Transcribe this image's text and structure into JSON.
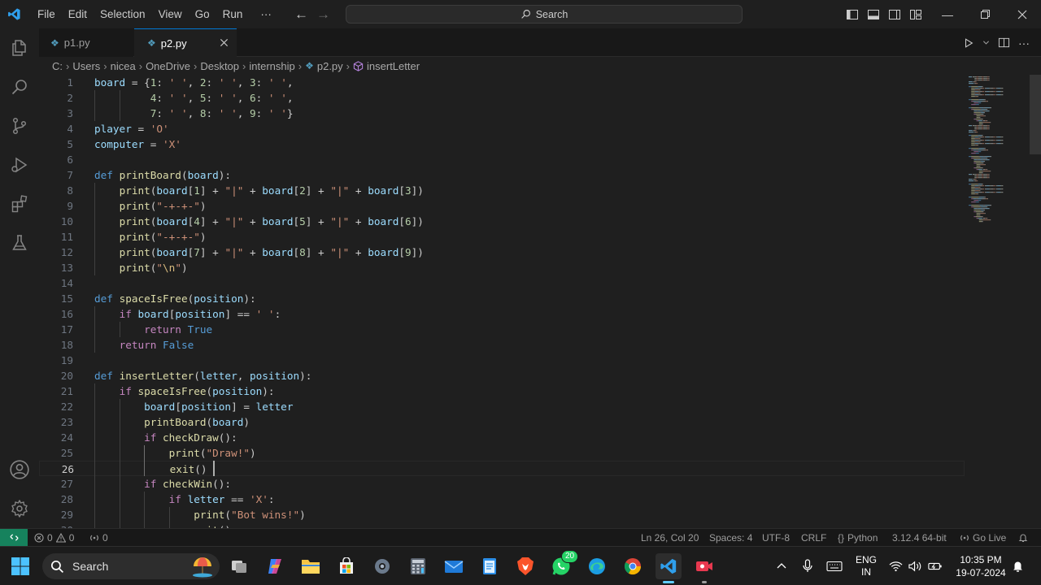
{
  "menu": [
    "File",
    "Edit",
    "Selection",
    "View",
    "Go",
    "Run",
    "···"
  ],
  "search": {
    "label": "Search"
  },
  "tabs": [
    {
      "label": "p1.py",
      "active": false
    },
    {
      "label": "p2.py",
      "active": true
    }
  ],
  "breadcrumb": [
    "C:",
    "Users",
    "nicea",
    "OneDrive",
    "Desktop",
    "internship",
    "p2.py",
    "insertLetter"
  ],
  "editor": {
    "current_line": 26,
    "lines": [
      [
        [
          "v",
          "board"
        ],
        [
          "o",
          " = {"
        ],
        [
          "n",
          "1"
        ],
        [
          "o",
          ": "
        ],
        [
          "s",
          "' '"
        ],
        [
          "o",
          ", "
        ],
        [
          "n",
          "2"
        ],
        [
          "o",
          ": "
        ],
        [
          "s",
          "' '"
        ],
        [
          "o",
          ", "
        ],
        [
          "n",
          "3"
        ],
        [
          "o",
          ": "
        ],
        [
          "s",
          "' '"
        ],
        [
          "o",
          ","
        ]
      ],
      [
        [
          "o",
          "         "
        ],
        [
          "n",
          "4"
        ],
        [
          "o",
          ": "
        ],
        [
          "s",
          "' '"
        ],
        [
          "o",
          ", "
        ],
        [
          "n",
          "5"
        ],
        [
          "o",
          ": "
        ],
        [
          "s",
          "' '"
        ],
        [
          "o",
          ", "
        ],
        [
          "n",
          "6"
        ],
        [
          "o",
          ": "
        ],
        [
          "s",
          "' '"
        ],
        [
          "o",
          ","
        ]
      ],
      [
        [
          "o",
          "         "
        ],
        [
          "n",
          "7"
        ],
        [
          "o",
          ": "
        ],
        [
          "s",
          "' '"
        ],
        [
          "o",
          ", "
        ],
        [
          "n",
          "8"
        ],
        [
          "o",
          ": "
        ],
        [
          "s",
          "' '"
        ],
        [
          "o",
          ", "
        ],
        [
          "n",
          "9"
        ],
        [
          "o",
          ": "
        ],
        [
          "s",
          "' '"
        ],
        [
          "o",
          "}"
        ]
      ],
      [
        [
          "v",
          "player"
        ],
        [
          "o",
          " = "
        ],
        [
          "s",
          "'O'"
        ]
      ],
      [
        [
          "v",
          "computer"
        ],
        [
          "o",
          " = "
        ],
        [
          "s",
          "'X'"
        ]
      ],
      [],
      [
        [
          "k",
          "def "
        ],
        [
          "f",
          "printBoard"
        ],
        [
          "o",
          "("
        ],
        [
          "v",
          "board"
        ],
        [
          "o",
          "):"
        ]
      ],
      [
        [
          "o",
          "    "
        ],
        [
          "f",
          "print"
        ],
        [
          "o",
          "("
        ],
        [
          "v",
          "board"
        ],
        [
          "o",
          "["
        ],
        [
          "n",
          "1"
        ],
        [
          "o",
          "] + "
        ],
        [
          "s",
          "\"|\""
        ],
        [
          "o",
          " + "
        ],
        [
          "v",
          "board"
        ],
        [
          "o",
          "["
        ],
        [
          "n",
          "2"
        ],
        [
          "o",
          "] + "
        ],
        [
          "s",
          "\"|\""
        ],
        [
          "o",
          " + "
        ],
        [
          "v",
          "board"
        ],
        [
          "o",
          "["
        ],
        [
          "n",
          "3"
        ],
        [
          "o",
          "])"
        ]
      ],
      [
        [
          "o",
          "    "
        ],
        [
          "f",
          "print"
        ],
        [
          "o",
          "("
        ],
        [
          "s",
          "\"-+-+-\""
        ],
        [
          "o",
          ")"
        ]
      ],
      [
        [
          "o",
          "    "
        ],
        [
          "f",
          "print"
        ],
        [
          "o",
          "("
        ],
        [
          "v",
          "board"
        ],
        [
          "o",
          "["
        ],
        [
          "n",
          "4"
        ],
        [
          "o",
          "] + "
        ],
        [
          "s",
          "\"|\""
        ],
        [
          "o",
          " + "
        ],
        [
          "v",
          "board"
        ],
        [
          "o",
          "["
        ],
        [
          "n",
          "5"
        ],
        [
          "o",
          "] + "
        ],
        [
          "s",
          "\"|\""
        ],
        [
          "o",
          " + "
        ],
        [
          "v",
          "board"
        ],
        [
          "o",
          "["
        ],
        [
          "n",
          "6"
        ],
        [
          "o",
          "])"
        ]
      ],
      [
        [
          "o",
          "    "
        ],
        [
          "f",
          "print"
        ],
        [
          "o",
          "("
        ],
        [
          "s",
          "\"-+-+-\""
        ],
        [
          "o",
          ")"
        ]
      ],
      [
        [
          "o",
          "    "
        ],
        [
          "f",
          "print"
        ],
        [
          "o",
          "("
        ],
        [
          "v",
          "board"
        ],
        [
          "o",
          "["
        ],
        [
          "n",
          "7"
        ],
        [
          "o",
          "] + "
        ],
        [
          "s",
          "\"|\""
        ],
        [
          "o",
          " + "
        ],
        [
          "v",
          "board"
        ],
        [
          "o",
          "["
        ],
        [
          "n",
          "8"
        ],
        [
          "o",
          "] + "
        ],
        [
          "s",
          "\"|\""
        ],
        [
          "o",
          " + "
        ],
        [
          "v",
          "board"
        ],
        [
          "o",
          "["
        ],
        [
          "n",
          "9"
        ],
        [
          "o",
          "])"
        ]
      ],
      [
        [
          "o",
          "    "
        ],
        [
          "f",
          "print"
        ],
        [
          "o",
          "("
        ],
        [
          "s",
          "\""
        ],
        [
          "e",
          "\\n"
        ],
        [
          "s",
          "\""
        ],
        [
          "o",
          ")"
        ]
      ],
      [],
      [
        [
          "k",
          "def "
        ],
        [
          "f",
          "spaceIsFree"
        ],
        [
          "o",
          "("
        ],
        [
          "v",
          "position"
        ],
        [
          "o",
          "):"
        ]
      ],
      [
        [
          "o",
          "    "
        ],
        [
          "c",
          "if "
        ],
        [
          "v",
          "board"
        ],
        [
          "o",
          "["
        ],
        [
          "v",
          "position"
        ],
        [
          "o",
          "] == "
        ],
        [
          "s",
          "' '"
        ],
        [
          "o",
          ":"
        ]
      ],
      [
        [
          "o",
          "        "
        ],
        [
          "c",
          "return "
        ],
        [
          "k",
          "True"
        ]
      ],
      [
        [
          "o",
          "    "
        ],
        [
          "c",
          "return "
        ],
        [
          "k",
          "False"
        ]
      ],
      [],
      [
        [
          "k",
          "def "
        ],
        [
          "f",
          "insertLetter"
        ],
        [
          "o",
          "("
        ],
        [
          "v",
          "letter"
        ],
        [
          "o",
          ", "
        ],
        [
          "v",
          "position"
        ],
        [
          "o",
          "):"
        ]
      ],
      [
        [
          "o",
          "    "
        ],
        [
          "c",
          "if "
        ],
        [
          "f",
          "spaceIsFree"
        ],
        [
          "o",
          "("
        ],
        [
          "v",
          "position"
        ],
        [
          "o",
          "):"
        ]
      ],
      [
        [
          "o",
          "        "
        ],
        [
          "v",
          "board"
        ],
        [
          "o",
          "["
        ],
        [
          "v",
          "position"
        ],
        [
          "o",
          "] = "
        ],
        [
          "v",
          "letter"
        ]
      ],
      [
        [
          "o",
          "        "
        ],
        [
          "f",
          "printBoard"
        ],
        [
          "o",
          "("
        ],
        [
          "v",
          "board"
        ],
        [
          "o",
          ")"
        ]
      ],
      [
        [
          "o",
          "        "
        ],
        [
          "c",
          "if "
        ],
        [
          "f",
          "checkDraw"
        ],
        [
          "o",
          "():"
        ]
      ],
      [
        [
          "o",
          "            "
        ],
        [
          "f",
          "print"
        ],
        [
          "o",
          "("
        ],
        [
          "s",
          "\"Draw!\""
        ],
        [
          "o",
          ")"
        ]
      ],
      [
        [
          "o",
          "            "
        ],
        [
          "f",
          "exit"
        ],
        [
          "o",
          "()"
        ]
      ],
      [
        [
          "o",
          "        "
        ],
        [
          "c",
          "if "
        ],
        [
          "f",
          "checkWin"
        ],
        [
          "o",
          "():"
        ]
      ],
      [
        [
          "o",
          "            "
        ],
        [
          "c",
          "if "
        ],
        [
          "v",
          "letter"
        ],
        [
          "o",
          " == "
        ],
        [
          "s",
          "'X'"
        ],
        [
          "o",
          ":"
        ]
      ],
      [
        [
          "o",
          "                "
        ],
        [
          "f",
          "print"
        ],
        [
          "o",
          "("
        ],
        [
          "s",
          "\"Bot wins!\""
        ],
        [
          "o",
          ")"
        ]
      ],
      [
        [
          "o",
          "                "
        ],
        [
          "f",
          "exit"
        ],
        [
          "o",
          "()"
        ]
      ]
    ]
  },
  "colors": {
    "k": "#569cd6",
    "c": "#c586c0",
    "f": "#dcdcaa",
    "v": "#9cdcfe",
    "s": "#ce9178",
    "n": "#b5cea8",
    "e": "#d7ba7d",
    "o": "#cccccc",
    "accent": "#0078d4",
    "remote": "#16825d"
  },
  "status": {
    "errors": "0",
    "warnings": "0",
    "ports": "0",
    "position": "Ln 26, Col 20",
    "spaces": "Spaces: 4",
    "encoding": "UTF-8",
    "eol": "CRLF",
    "language": "Python",
    "interpreter": "3.12.4 64-bit",
    "golive": "Go Live"
  },
  "taskbar": {
    "search": "Search",
    "whatsapp_badge": "20",
    "lang1": "ENG",
    "lang2": "IN",
    "time": "10:35 PM",
    "date": "19-07-2024"
  }
}
